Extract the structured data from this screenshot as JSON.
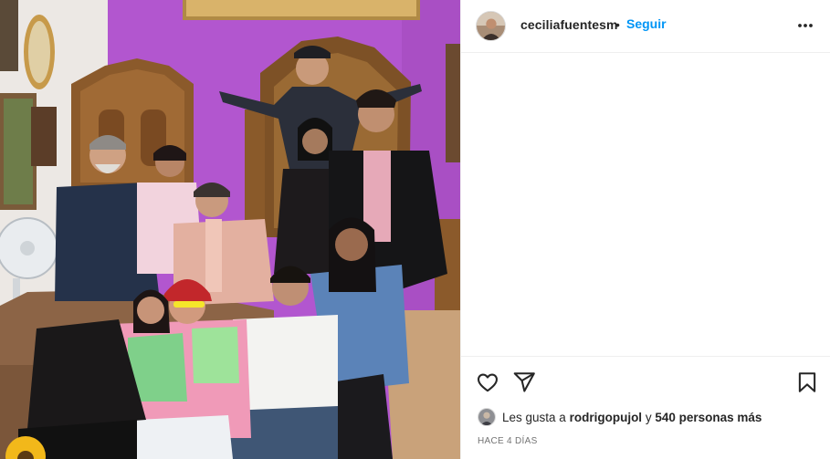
{
  "post": {
    "username": "ceciliafuentesm",
    "separator": "•",
    "follow_label": "Seguir",
    "more_icon": "more-horizontal-icon"
  },
  "actions": {
    "like_icon": "heart-icon",
    "share_icon": "paper-plane-icon",
    "save_icon": "bookmark-icon"
  },
  "likes": {
    "prefix": "Les gusta a",
    "user": "rodrigopujol",
    "connector": "y",
    "others": "540 personas más"
  },
  "timestamp": "HACE 4 DÍAS",
  "colors": {
    "link_blue": "#0095f6",
    "text": "#262626",
    "muted": "#737373",
    "border": "#efefef",
    "wall_purple": "#b65ad0"
  }
}
